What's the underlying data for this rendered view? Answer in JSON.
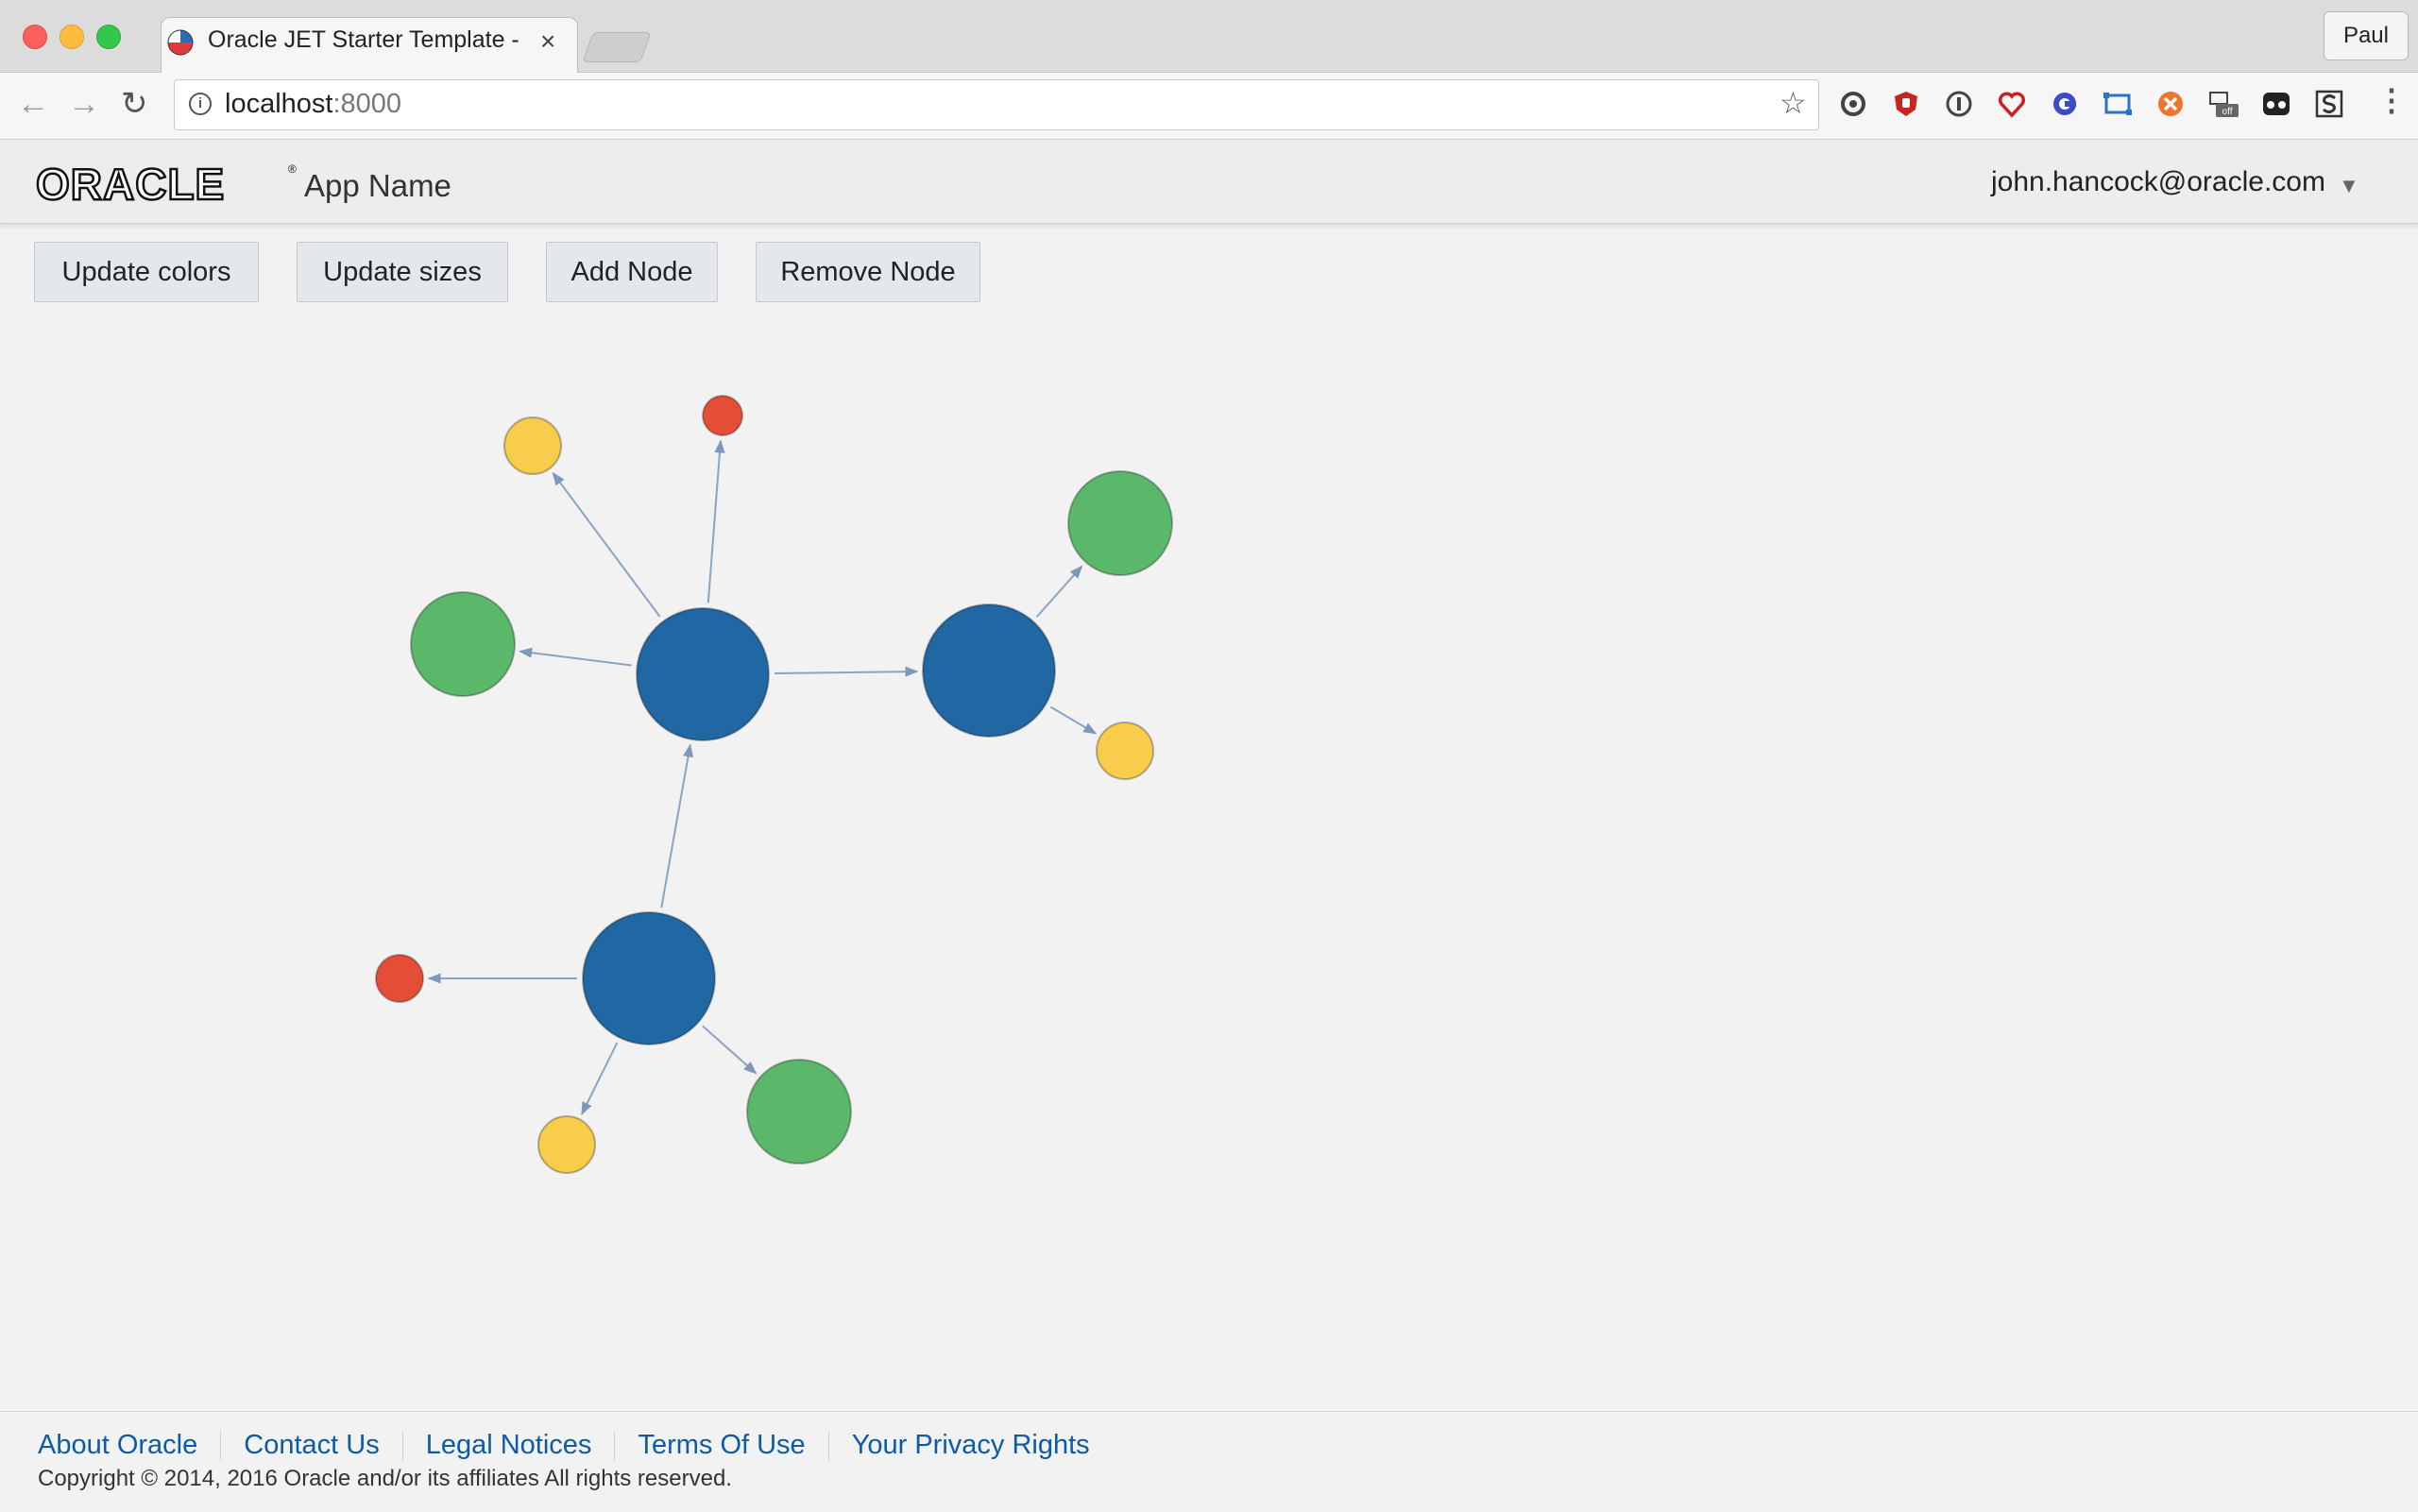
{
  "browser": {
    "tab_title": "Oracle JET Starter Template - ",
    "tab_close": "×",
    "profile_name": "Paul",
    "url_host": "localhost",
    "url_port": ":8000",
    "back_icon": "←",
    "forward_icon": "→",
    "reload_icon": "↻",
    "star_icon": "☆",
    "info_icon": "i",
    "menu_icon": "⋮"
  },
  "header": {
    "logo_text": "ORACLE",
    "logo_reg": "®",
    "app_name": "App Name",
    "user_email": "john.hancock@oracle.com",
    "user_caret": "▼"
  },
  "actions": {
    "update_colors": "Update colors",
    "update_sizes": "Update sizes",
    "add_node": "Add Node",
    "remove_node": "Remove Node"
  },
  "colors": {
    "blue": "#2067a3",
    "green": "#5bb86b",
    "yellow": "#f7cd4b",
    "red": "#e44e37",
    "link": "#8aa4c4"
  },
  "graph": {
    "nodes": [
      {
        "id": "hub-1",
        "color": "blue"
      },
      {
        "id": "hub-2",
        "color": "blue"
      },
      {
        "id": "hub-3",
        "color": "blue"
      },
      {
        "id": "leaf-yellow-1",
        "color": "yellow"
      },
      {
        "id": "leaf-red-1",
        "color": "red"
      },
      {
        "id": "leaf-green-1",
        "color": "green"
      },
      {
        "id": "leaf-green-2",
        "color": "green"
      },
      {
        "id": "leaf-yellow-2",
        "color": "yellow"
      },
      {
        "id": "leaf-red-2",
        "color": "red"
      },
      {
        "id": "leaf-yellow-3",
        "color": "yellow"
      },
      {
        "id": "leaf-green-3",
        "color": "green"
      }
    ],
    "links": [
      {
        "source": "hub-1",
        "target": "leaf-yellow-1"
      },
      {
        "source": "hub-1",
        "target": "leaf-red-1"
      },
      {
        "source": "hub-1",
        "target": "leaf-green-1"
      },
      {
        "source": "hub-1",
        "target": "hub-2"
      },
      {
        "source": "hub-2",
        "target": "leaf-green-2"
      },
      {
        "source": "hub-2",
        "target": "leaf-yellow-2"
      },
      {
        "source": "hub-3",
        "target": "hub-1"
      },
      {
        "source": "hub-3",
        "target": "leaf-red-2"
      },
      {
        "source": "hub-3",
        "target": "leaf-yellow-3"
      },
      {
        "source": "hub-3",
        "target": "leaf-green-3"
      }
    ]
  },
  "footer": {
    "links": [
      "About Oracle",
      "Contact Us",
      "Legal Notices",
      "Terms Of Use",
      "Your Privacy Rights"
    ],
    "copyright": "Copyright © 2014, 2016 Oracle and/or its affiliates All rights reserved."
  }
}
